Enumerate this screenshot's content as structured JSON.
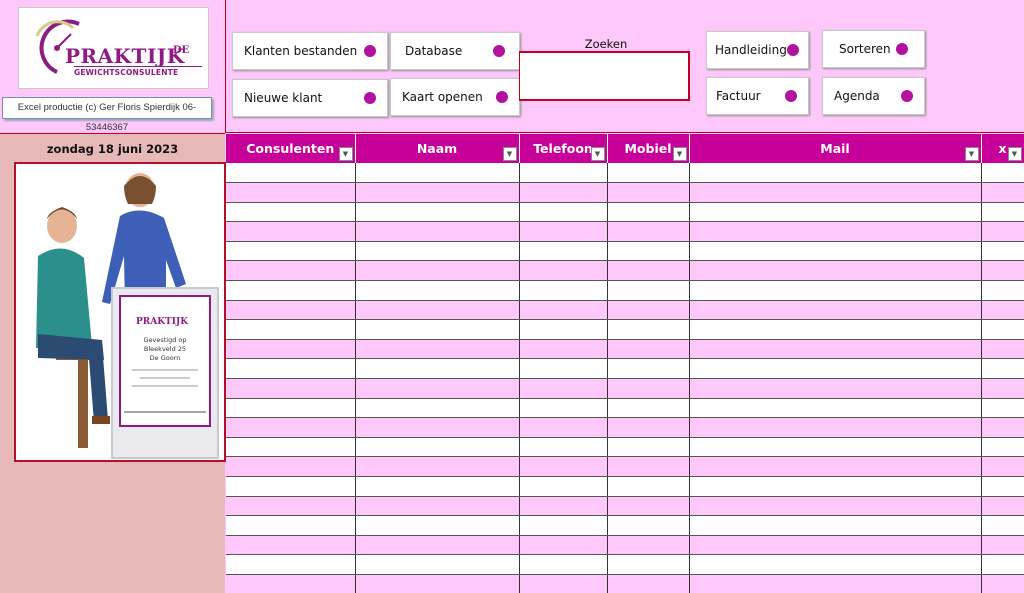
{
  "logo": {
    "word": "PRAKTIJK",
    "de": "DE",
    "sub": "GEWICHTSCONSULENTE",
    "credit": "Excel productie (c) Ger Floris Spierdijk 06-53446367"
  },
  "date_label": "zondag 18 juni 2023",
  "buttons": {
    "klanten_bestanden": "Klanten bestanden",
    "database": "Database",
    "nieuwe_klant": "Nieuwe klant",
    "kaart_openen": "Kaart openen",
    "handleiding": "Handleiding",
    "sorteren": "Sorteren",
    "factuur": "Factuur",
    "agenda": "Agenda"
  },
  "search": {
    "label": "Zoeken",
    "value": ""
  },
  "sign": {
    "line1": "Gevestigd op",
    "line2": "Bleekveld 25",
    "line3": "De Goorn"
  },
  "table": {
    "columns": [
      "Consulenten",
      "Naam",
      "Telefoon",
      "Mobiel",
      "Mail",
      "x"
    ],
    "row_count": 22
  },
  "colors": {
    "accent": "#c8009a",
    "pink_bg": "#ffc8fb",
    "dot": "#b3119e",
    "border_red": "#c00020"
  }
}
